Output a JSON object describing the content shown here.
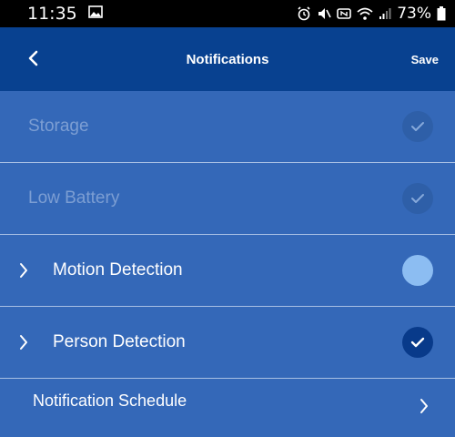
{
  "status_bar": {
    "time": "11:35",
    "battery": "73%"
  },
  "header": {
    "title": "Notifications",
    "save_label": "Save"
  },
  "rows": [
    {
      "label": "Storage",
      "enabled": false,
      "checked": true
    },
    {
      "label": "Low Battery",
      "enabled": false,
      "checked": true
    },
    {
      "label": "Motion Detection",
      "enabled": true,
      "checked": false,
      "expandable": true
    },
    {
      "label": "Person Detection",
      "enabled": true,
      "checked": true,
      "expandable": true
    }
  ],
  "schedule": {
    "label": "Notification Schedule"
  },
  "colors": {
    "header_bg": "#084190",
    "list_bg": "#3468b8",
    "divider": "#a8c0e4",
    "disabled_text": "#7c9ed3",
    "check_on": "#083a8a",
    "toggle_off": "#8cbdf2"
  }
}
